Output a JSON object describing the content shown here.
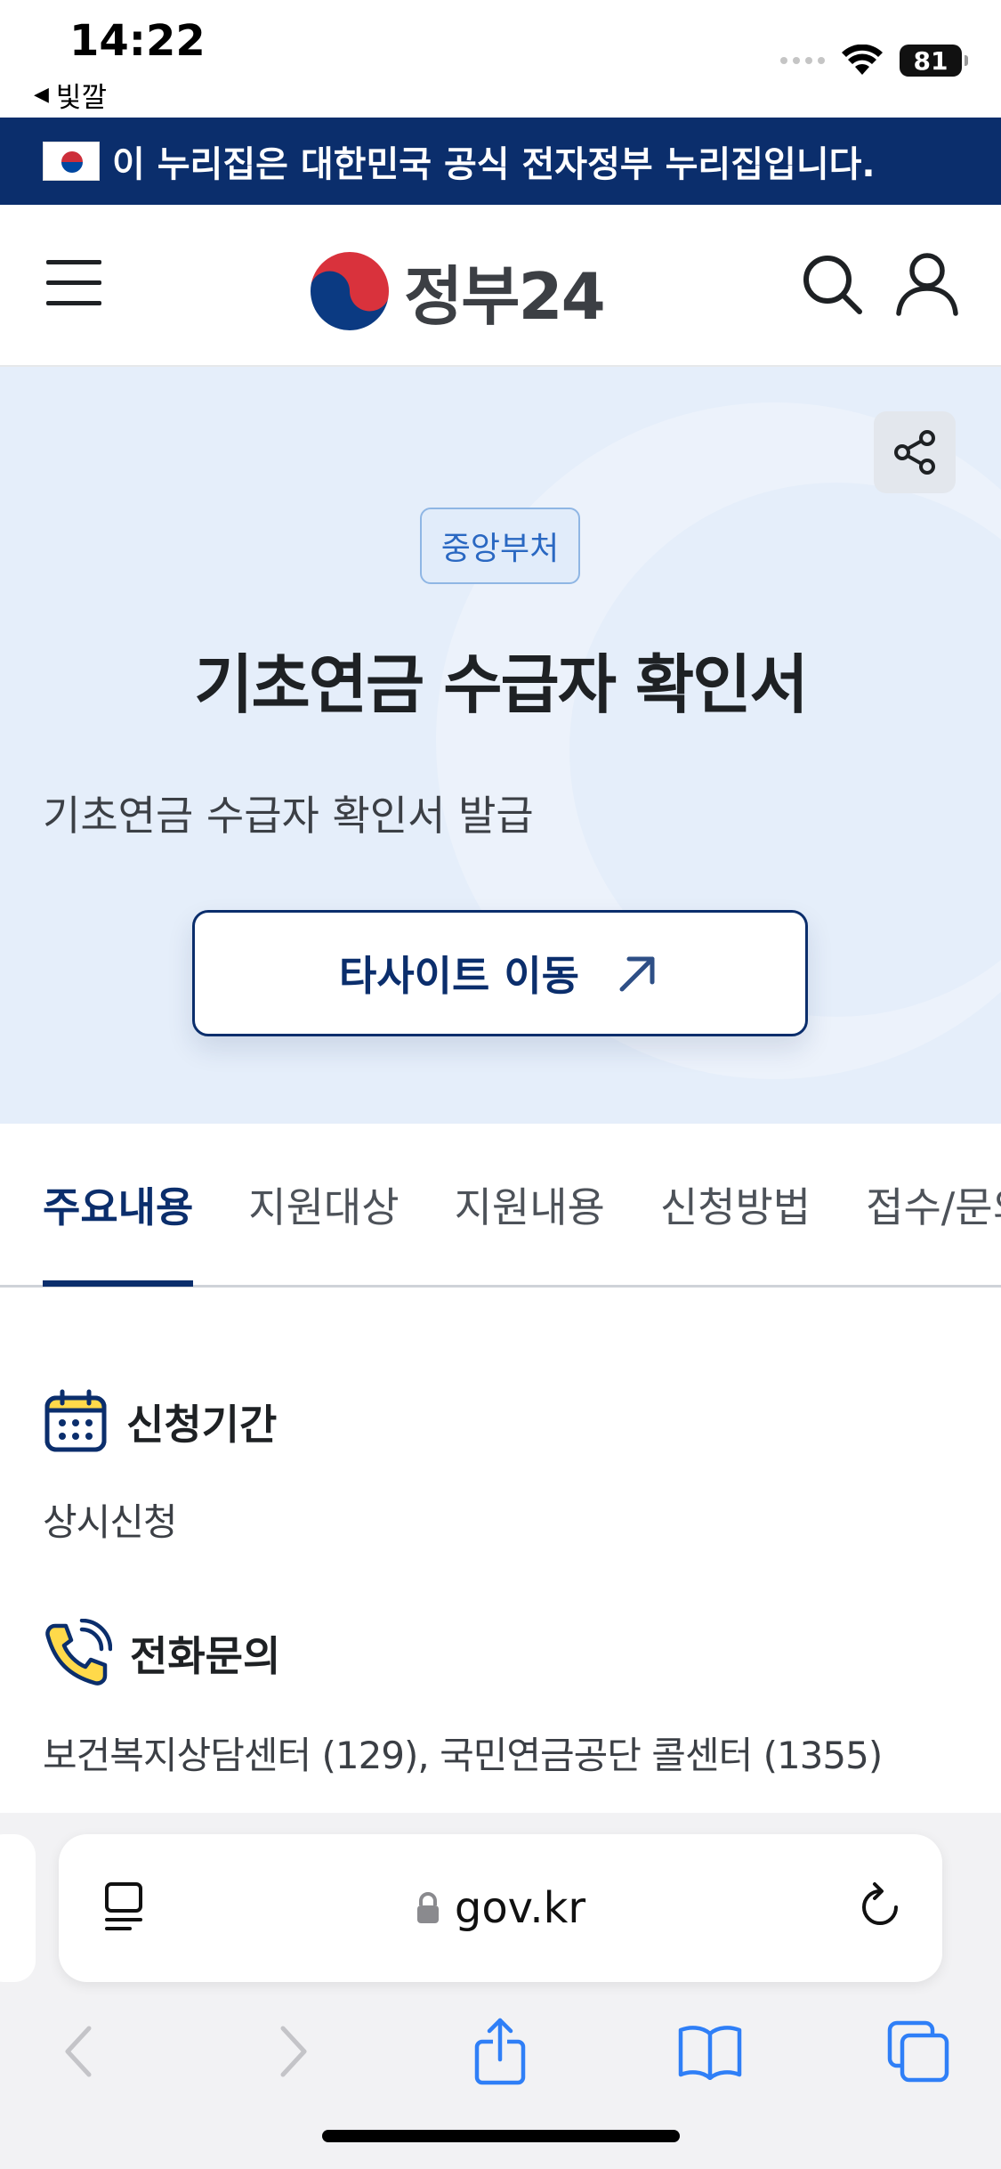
{
  "status": {
    "time": "14:22",
    "back_label": "빛깔",
    "battery": "81"
  },
  "banner": {
    "text": "이 누리집은 대한민국 공식 전자정부 누리집입니다."
  },
  "header": {
    "logo_text": "정부24"
  },
  "hero": {
    "badge": "중앙부처",
    "title": "기초연금 수급자 확인서",
    "description": "기초연금 수급자 확인서 발급",
    "site_button": "타사이트 이동"
  },
  "tabs": [
    {
      "label": "주요내용",
      "active": true
    },
    {
      "label": "지원대상",
      "active": false
    },
    {
      "label": "지원내용",
      "active": false
    },
    {
      "label": "신청방법",
      "active": false
    },
    {
      "label": "접수/문의",
      "active": false
    }
  ],
  "info": {
    "period_title": "신청기간",
    "period_value": "상시신청",
    "phone_title": "전화문의",
    "phone_value": "보건복지상담센터 (129), 국민연금공단 콜센터 (1355)"
  },
  "browser": {
    "url": "gov.kr"
  },
  "colors": {
    "primary": "#0b2e6c",
    "hero_bg": "#e5eefa",
    "badge_text": "#2a68c2"
  }
}
